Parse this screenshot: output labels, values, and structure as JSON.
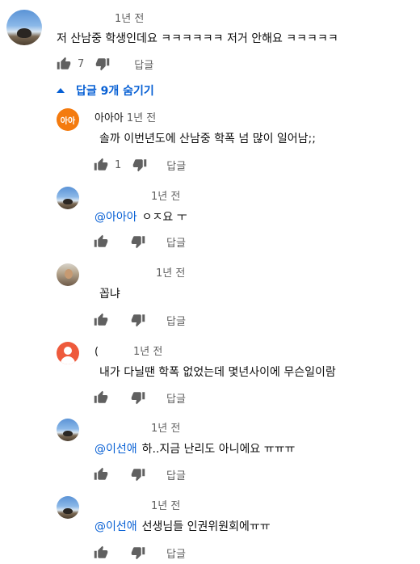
{
  "top_comment": {
    "author": "",
    "time": "1년 전",
    "text": "저 산남중 학생인데요 ㅋㅋㅋㅋㅋㅋ 저거 안해요 ㅋㅋㅋㅋㅋ",
    "likes": "7",
    "reply_label": "답글"
  },
  "replies_toggle": {
    "label": "답글 9개 숨기기"
  },
  "replies": [
    {
      "author": "아아아",
      "time": "1년 전",
      "mention": "",
      "text": "솔까 이번년도에 산남중 학폭 넘 많이 일어남;;",
      "likes": "1",
      "reply_label": "답글",
      "avatar_text": "아아"
    },
    {
      "author": "",
      "time": "1년 전",
      "mention": "@아아아",
      "text": "ㅇㅈ요 ㅜ",
      "likes": "",
      "reply_label": "답글"
    },
    {
      "author": "",
      "time": "1년 전",
      "mention": "",
      "text": "꼽냐",
      "likes": "",
      "reply_label": "답글"
    },
    {
      "author": "(",
      "time": "1년 전",
      "mention": "",
      "text": "내가 다닐땐 학폭 없었는데 몇년사이에 무슨일이람",
      "likes": "",
      "reply_label": "답글"
    },
    {
      "author": "",
      "time": "1년 전",
      "mention": "@이선애",
      "text": "하..지금 난리도 아니에요 ㅠㅠㅠ",
      "likes": "",
      "reply_label": "답글"
    },
    {
      "author": "",
      "time": "1년 전",
      "mention": "@이선애",
      "text": "선생님들 인권위원회에ㅠㅠ",
      "likes": "",
      "reply_label": "답글"
    }
  ],
  "icons": {
    "like": "thumb-up-icon",
    "dislike": "thumb-down-icon",
    "toggle": "caret-up-icon"
  },
  "colors": {
    "link": "#065fd4",
    "meta": "#606060"
  }
}
